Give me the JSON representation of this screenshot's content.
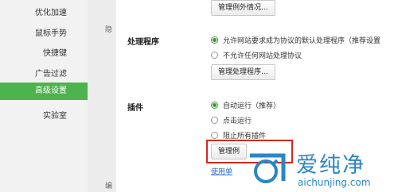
{
  "sidebar": {
    "items": [
      {
        "label": "优化加速"
      },
      {
        "label": "鼠标手势"
      },
      {
        "label": "快捷键"
      },
      {
        "label": "广告过滤"
      },
      {
        "label": "高级设置",
        "active": true
      },
      {
        "label": "实验室"
      }
    ],
    "truncated_labels": [
      "隐",
      "编"
    ]
  },
  "exceptions": {
    "manage_button": "管理例外情况..."
  },
  "protocol_handlers": {
    "section_label": "处理程序",
    "options": [
      {
        "label": "允许网站要求成为协议的默认处理程序（推荐设置",
        "selected": true
      },
      {
        "label": "不允许任何网站处理协议",
        "selected": false
      }
    ],
    "manage_button": "管理处理程序..."
  },
  "plugins": {
    "section_label": "插件",
    "options": [
      {
        "label": "自动运行（推荐）",
        "selected": true
      },
      {
        "label": "点击运行",
        "selected": false
      },
      {
        "label": "阻止所有插件",
        "selected": false
      }
    ],
    "manage_button": "管理例",
    "help_link": "使用单"
  },
  "watermark": {
    "brand": "爱纯净",
    "url": "aichunjing.com"
  },
  "colors": {
    "accent": "#4db34d",
    "radio_on": "#3a9a3a",
    "highlight": "#d9261c",
    "watermark": "#2b86c6"
  }
}
